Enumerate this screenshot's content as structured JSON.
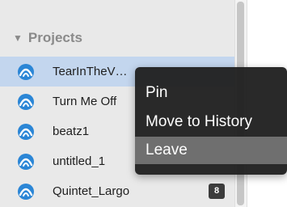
{
  "sidebar": {
    "section_title": "Projects",
    "section_toggle_icon": "triangle-down-icon",
    "project_icon": "logo-arc-icon",
    "projects": [
      {
        "name": "TearInTheV…",
        "selected": true
      },
      {
        "name": "Turn Me Off",
        "selected": false
      },
      {
        "name": "beatz1",
        "selected": false
      },
      {
        "name": "untitled_1",
        "selected": false
      },
      {
        "name": "Quintet_Largo",
        "selected": false,
        "badge": "8"
      }
    ]
  },
  "context_menu": {
    "items": [
      {
        "label": "Pin"
      },
      {
        "label": "Move to History"
      },
      {
        "label": "Leave",
        "highlighted": true
      }
    ]
  },
  "colors": {
    "selected_row": "#c3d6ee",
    "icon_blue": "#2b86d6",
    "menu_background": "#202020",
    "menu_highlight": "#6f6f6f"
  }
}
